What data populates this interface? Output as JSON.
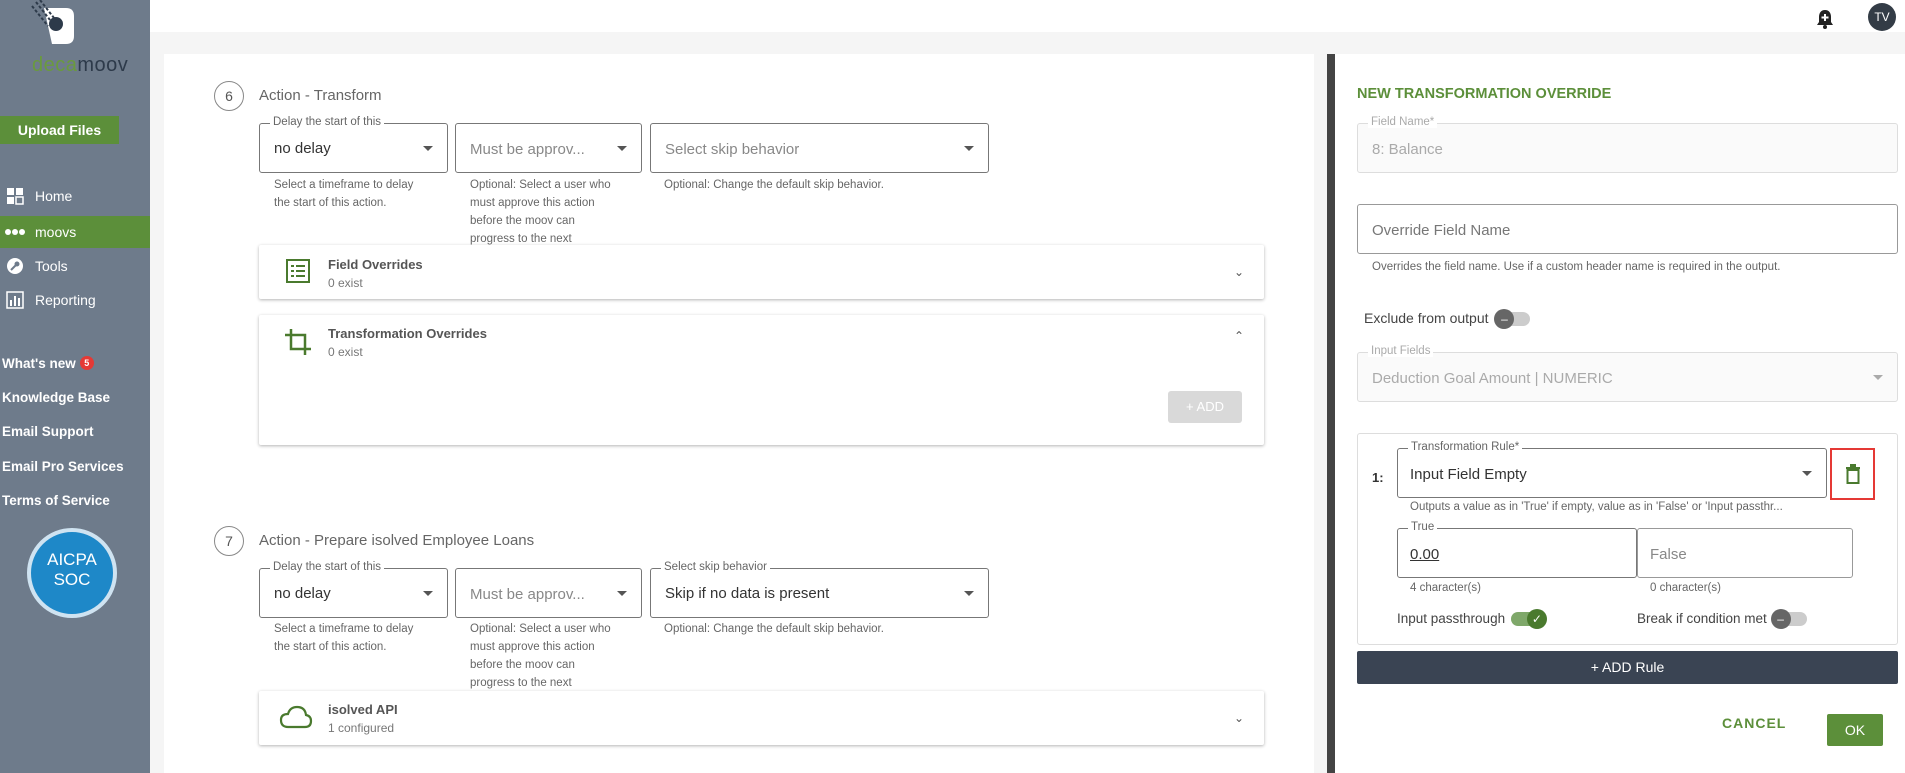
{
  "brand": {
    "logo_part1": "deca",
    "logo_part2": "moov",
    "accent": "#5c8f3a"
  },
  "sidebar": {
    "upload_label": "Upload Files",
    "nav": [
      {
        "label": "Home",
        "icon": "home-icon"
      },
      {
        "label": "moovs",
        "icon": "moovs-icon"
      },
      {
        "label": "Tools",
        "icon": "wrench-icon"
      },
      {
        "label": "Reporting",
        "icon": "chart-icon"
      }
    ],
    "links": {
      "whats_new": "What's new",
      "whats_new_badge": "5",
      "knowledge_base": "Knowledge Base",
      "email_support": "Email Support",
      "email_pro": "Email Pro Services",
      "terms": "Terms of Service"
    },
    "aicpa_line1": "AICPA",
    "aicpa_line2": "SOC"
  },
  "topbar": {
    "avatar_initials": "TV"
  },
  "main": {
    "step6": {
      "number": "6",
      "title": "Action - Transform",
      "delay_label": "Delay the start of this",
      "delay_value": "no delay",
      "delay_help": "Select a timeframe to delay the start of this action.",
      "approve_placeholder": "Must be approv...",
      "approve_help": "Optional: Select a user who must approve this action before the moov can progress to the next",
      "skip_placeholder": "Select skip behavior",
      "skip_help": "Optional: Change the default skip behavior.",
      "field_overrides_title": "Field Overrides",
      "field_overrides_sub": "0 exist",
      "transformation_title": "Transformation Overrides",
      "transformation_sub": "0 exist",
      "add_label": "+ ADD"
    },
    "step7": {
      "number": "7",
      "title": "Action - Prepare isolved Employee Loans",
      "delay_label": "Delay the start of this",
      "delay_value": "no delay",
      "delay_help": "Select a timeframe to delay the start of this action.",
      "approve_placeholder": "Must be approv...",
      "approve_help": "Optional: Select a user who must approve this action before the moov can progress to the next",
      "skip_label": "Select skip behavior",
      "skip_value": "Skip if no data is present",
      "skip_help": "Optional: Change the default skip behavior.",
      "api_title": "isolved API",
      "api_sub": "1 configured"
    }
  },
  "panel": {
    "title": "NEW TRANSFORMATION OVERRIDE",
    "field_name_label": "Field Name*",
    "field_name_value": "8: Balance",
    "override_placeholder": "Override Field Name",
    "override_help": "Overrides the field name. Use if a custom header name is required in the output.",
    "exclude_label": "Exclude from output",
    "input_fields_label": "Input Fields",
    "input_fields_value": "Deduction Goal Amount | NUMERIC",
    "rule": {
      "index": "1:",
      "rule_label": "Transformation Rule*",
      "rule_value": "Input Field Empty",
      "rule_help": "Outputs a value as in 'True' if empty, value as in 'False' or 'Input passthr...",
      "true_label": "True",
      "true_value": "0.00",
      "true_count": "4 character(s)",
      "false_placeholder": "False",
      "false_count": "0 character(s)",
      "passthrough_label": "Input passthrough",
      "break_label": "Break if condition met"
    },
    "add_rule": "+ ADD Rule",
    "cancel": "CANCEL",
    "ok": "OK"
  }
}
